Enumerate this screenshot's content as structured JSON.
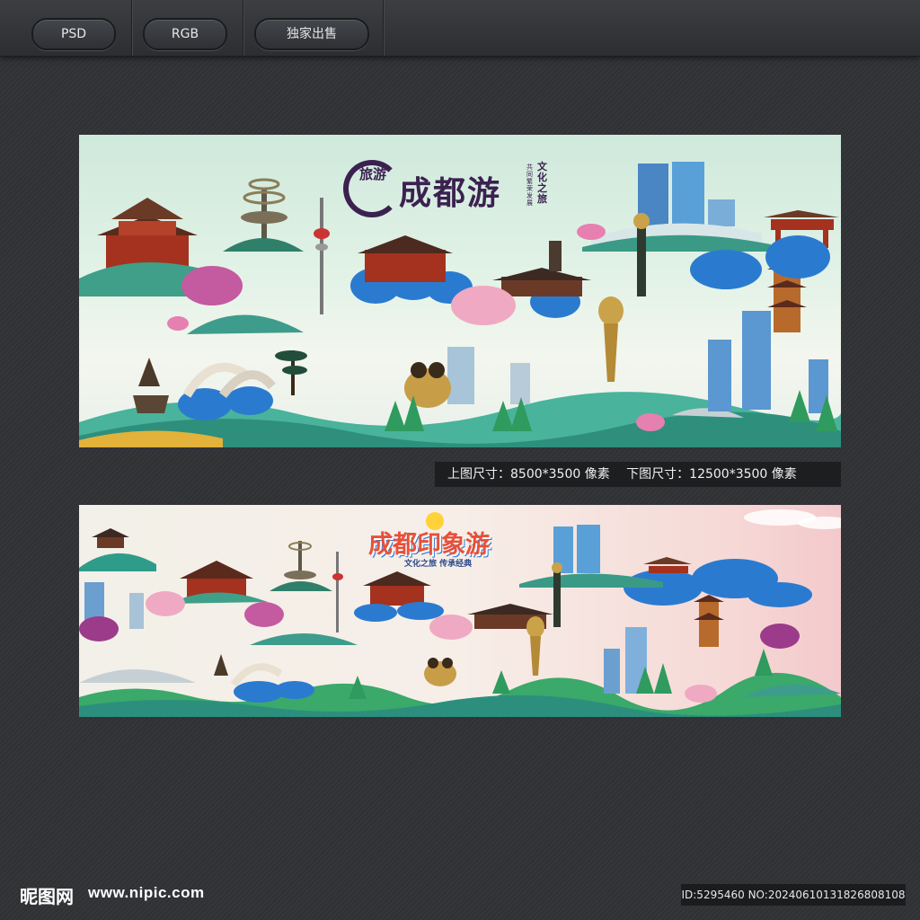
{
  "toolbar": {
    "buttons": [
      "PSD",
      "RGB",
      "独家出售"
    ]
  },
  "banner_top": {
    "badge": "旅游",
    "title": "成都游",
    "tagline": "文化之旅",
    "tagline_small": "共同繁荣发展"
  },
  "banner_bottom": {
    "title": "成都印象游",
    "tagline": "文化之旅 传承经典"
  },
  "info": {
    "top_size": "上图尺寸：8500*3500 像素",
    "bottom_size": "下图尺寸：12500*3500 像素"
  },
  "footer": {
    "logo": "昵图网",
    "url": "www.nipic.com",
    "id": "ID:5295460 NO:20240610131826808108"
  },
  "colors": {
    "page_bg": "#323437",
    "teal": "#2f9c8a",
    "blue_tree": "#2a7bd0",
    "purple_title": "#3b2150"
  }
}
